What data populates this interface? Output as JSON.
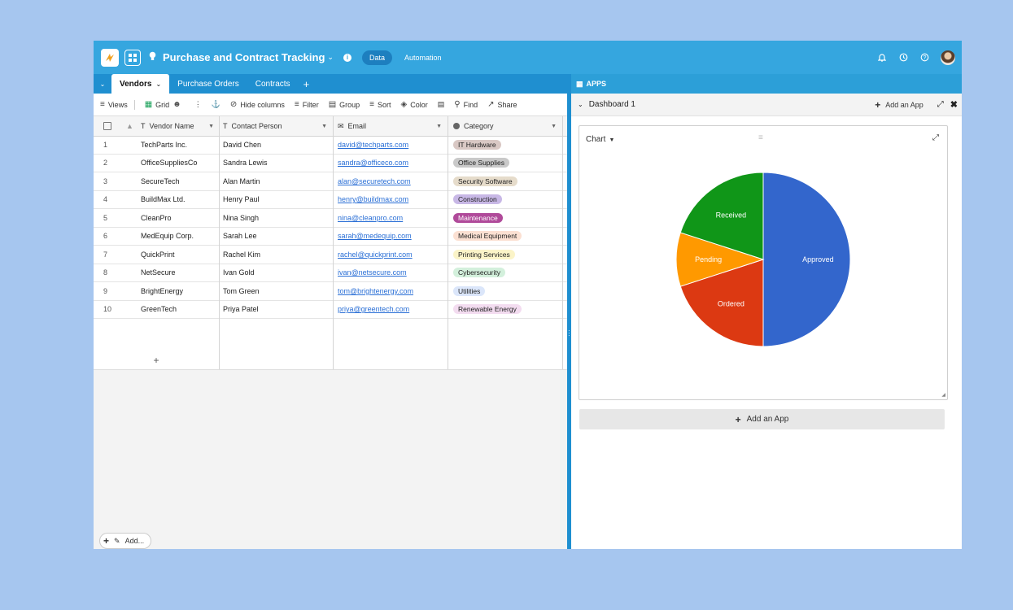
{
  "header": {
    "title": "Purchase and Contract Tracking",
    "data_label": "Data",
    "automation_label": "Automation"
  },
  "tabs": [
    {
      "label": "Vendors",
      "active": true
    },
    {
      "label": "Purchase Orders"
    },
    {
      "label": "Contracts"
    }
  ],
  "toolbar": {
    "views": "Views",
    "grid": "Grid",
    "hide_columns": "Hide columns",
    "filter": "Filter",
    "group": "Group",
    "sort": "Sort",
    "color": "Color",
    "find": "Find",
    "share": "Share"
  },
  "columns": [
    "Vendor Name",
    "Contact Person",
    "Email",
    "Category"
  ],
  "rows": [
    {
      "num": "1",
      "name": "TechParts Inc.",
      "contact": "David Chen",
      "email": "david@techparts.com",
      "category": "IT Hardware",
      "cat_bg": "#d9c8c4"
    },
    {
      "num": "2",
      "name": "OfficeSuppliesCo",
      "contact": "Sandra Lewis",
      "email": "sandra@officeco.com",
      "category": "Office Supplies",
      "cat_bg": "#c9c9c9"
    },
    {
      "num": "3",
      "name": "SecureTech",
      "contact": "Alan Martin",
      "email": "alan@securetech.com",
      "category": "Security Software",
      "cat_bg": "#e6dccb"
    },
    {
      "num": "4",
      "name": "BuildMax Ltd.",
      "contact": "Henry Paul",
      "email": "henry@buildmax.com",
      "category": "Construction",
      "cat_bg": "#c8b8e6"
    },
    {
      "num": "5",
      "name": "CleanPro",
      "contact": "Nina Singh",
      "email": "nina@cleanpro.com",
      "category": "Maintenance",
      "cat_bg": "#b04a9a",
      "cat_fg": "#ffffff"
    },
    {
      "num": "6",
      "name": "MedEquip Corp.",
      "contact": "Sarah Lee",
      "email": "sarah@medequip.com",
      "category": "Medical Equipment",
      "cat_bg": "#fbe0d2"
    },
    {
      "num": "7",
      "name": "QuickPrint",
      "contact": "Rachel Kim",
      "email": "rachel@quickprint.com",
      "category": "Printing Services",
      "cat_bg": "#fbf4c8"
    },
    {
      "num": "8",
      "name": "NetSecure",
      "contact": "Ivan Gold",
      "email": "ivan@netsecure.com",
      "category": "Cybersecurity",
      "cat_bg": "#d3f0dc"
    },
    {
      "num": "9",
      "name": "BrightEnergy",
      "contact": "Tom Green",
      "email": "tom@brightenergy.com",
      "category": "Utilities",
      "cat_bg": "#dbe6fa"
    },
    {
      "num": "10",
      "name": "GreenTech",
      "contact": "Priya Patel",
      "email": "priya@greentech.com",
      "category": "Renewable Energy",
      "cat_bg": "#f3dcf0"
    }
  ],
  "footer": {
    "add_label": "Add..."
  },
  "apps_panel": {
    "title": "APPS",
    "dashboard": "Dashboard 1",
    "add_app": "Add an App",
    "chart_selector": "Chart",
    "add_app_button": "Add an App"
  },
  "chart_data": {
    "type": "pie",
    "title": "",
    "slices": [
      {
        "label": "Approved",
        "value": 5,
        "color": "#3366cc"
      },
      {
        "label": "Ordered",
        "value": 2,
        "color": "#dc3912"
      },
      {
        "label": "Pending",
        "value": 1,
        "color": "#ff9900"
      },
      {
        "label": "Received",
        "value": 2,
        "color": "#109618"
      }
    ]
  }
}
